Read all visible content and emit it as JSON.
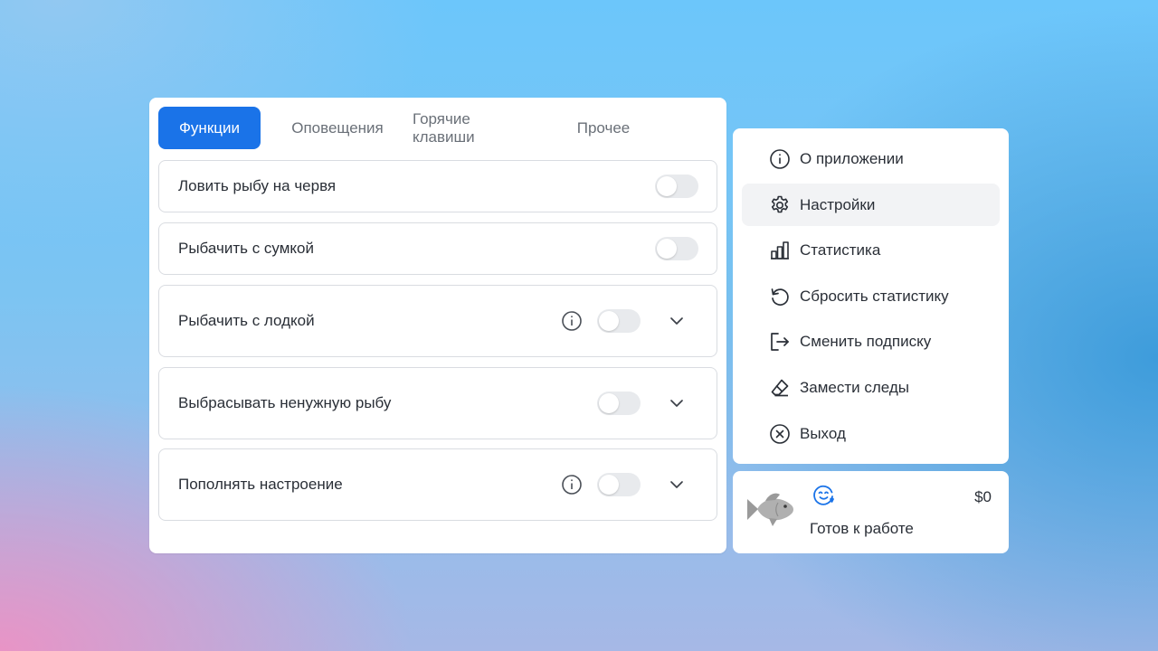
{
  "tabs": [
    {
      "label": "Функции",
      "active": true
    },
    {
      "label": "Оповещения",
      "active": false
    },
    {
      "label": "Горячие клавиши",
      "active": false
    },
    {
      "label": "Прочее",
      "active": false
    }
  ],
  "settings": [
    {
      "label": "Ловить рыбу на червя",
      "enabled": false,
      "info": false,
      "expandable": false
    },
    {
      "label": "Рыбачить с сумкой",
      "enabled": false,
      "info": false,
      "expandable": false
    },
    {
      "label": "Рыбачить с лодкой",
      "enabled": false,
      "info": true,
      "expandable": true
    },
    {
      "label": "Выбрасывать ненужную рыбу",
      "enabled": false,
      "info": false,
      "expandable": true
    },
    {
      "label": "Пополнять настроение",
      "enabled": false,
      "info": true,
      "expandable": true
    }
  ],
  "menu": [
    {
      "label": "О приложении",
      "icon": "info-icon",
      "selected": false
    },
    {
      "label": "Настройки",
      "icon": "gear-icon",
      "selected": true
    },
    {
      "label": "Статистика",
      "icon": "bar-chart-icon",
      "selected": false
    },
    {
      "label": "Сбросить статистику",
      "icon": "reset-icon",
      "selected": false
    },
    {
      "label": "Сменить подписку",
      "icon": "logout-icon",
      "selected": false
    },
    {
      "label": "Замести следы",
      "icon": "eraser-icon",
      "selected": false
    },
    {
      "label": "Выход",
      "icon": "close-circle-icon",
      "selected": false
    }
  ],
  "status": {
    "text": "Готов к работе",
    "balance": "$0",
    "icon": "smiley-icon"
  },
  "colors": {
    "accent": "#1a73e8",
    "toggle_off": "#e8eaed",
    "menu_selected": "#f2f3f5"
  }
}
